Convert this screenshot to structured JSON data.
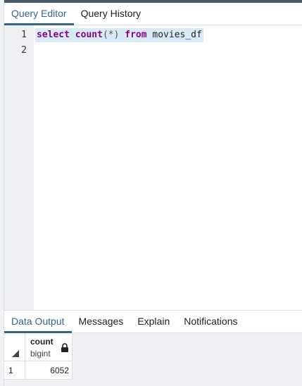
{
  "editor_tabs": {
    "query_editor": "Query Editor",
    "query_history": "Query History"
  },
  "editor": {
    "line_numbers": [
      "1",
      "2"
    ],
    "line1": {
      "kw1": "select",
      "fn": "count",
      "args": "(*)",
      "kw2": "from",
      "table": "movies_df"
    }
  },
  "result_tabs": {
    "data_output": "Data Output",
    "messages": "Messages",
    "explain": "Explain",
    "notifications": "Notifications"
  },
  "result_grid": {
    "column": {
      "name": "count",
      "type": "bigint"
    },
    "rows": [
      {
        "row_number": "1",
        "count": "6052"
      }
    ]
  },
  "icons": {
    "lock": "lock-icon",
    "sort_corner": "corner-triangle-icon"
  },
  "colors": {
    "accent": "#326690",
    "keyword": "#8b008b",
    "active_line": "#d9eaf7"
  }
}
